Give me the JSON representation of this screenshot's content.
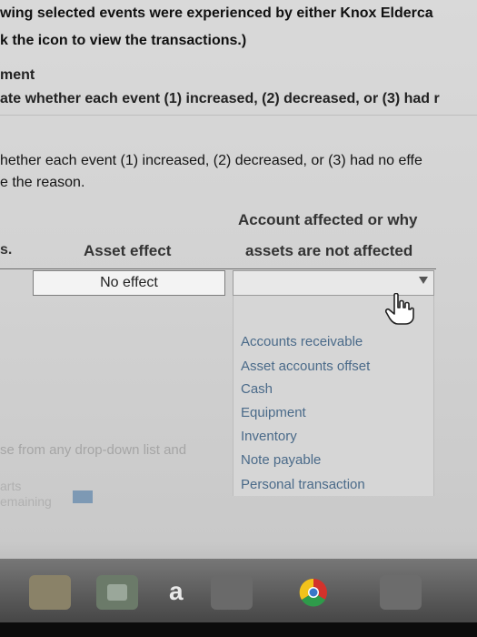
{
  "intro": {
    "line1": "wing selected events were experienced by either Knox Elderca",
    "line2": "k the icon to view the transactions.)"
  },
  "section": {
    "title": "ment",
    "instruction": "ate whether each event (1) increased, (2) decreased, or (3) had r"
  },
  "instructions": {
    "line1": "hether each event (1) increased, (2) decreased, or (3) had no effe",
    "line2": "e the reason."
  },
  "table": {
    "col_s": "s.",
    "col_asset": "Asset effect",
    "col_account_line1": "Account affected or why",
    "col_account_line2": "assets are not affected"
  },
  "row1": {
    "asset_effect_value": "No effect",
    "account_value": ""
  },
  "dropdown": {
    "options": [
      "Accounts receivable",
      "Asset accounts offset",
      "Cash",
      "Equipment",
      "Inventory",
      "Note payable",
      "Personal transaction"
    ]
  },
  "footer": {
    "hint": "se from any drop-down list and",
    "parts": "arts",
    "remaining": "emaining"
  },
  "taskbar": {
    "amazon_label": "a"
  },
  "colors": {
    "option_text": "#4a6a89",
    "remaining_chip": "#7d99b4",
    "chrome_red": "#d3322b",
    "chrome_green": "#2e9b4a",
    "chrome_yellow": "#f2c21b"
  },
  "icons": [
    "hand-pointer-icon",
    "dropdown-arrow-icon",
    "folder-icon",
    "store-icon",
    "chrome-icon"
  ]
}
